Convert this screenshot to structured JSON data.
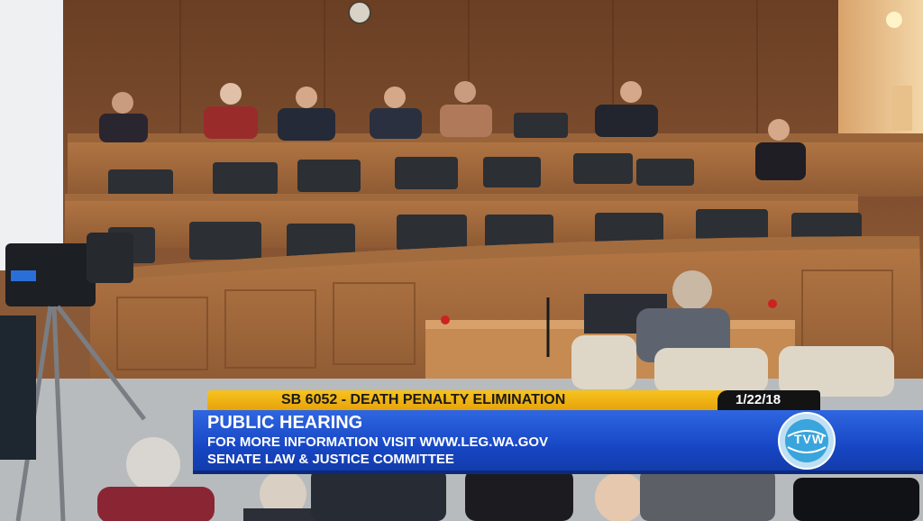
{
  "broadcast": {
    "bill_title": "SB 6052 - DEATH PENALTY ELIMINATION",
    "date": "1/22/18",
    "headline": "PUBLIC HEARING",
    "info_line": "FOR MORE INFORMATION VISIT WWW.LEG.WA.GOV",
    "committee": "SENATE LAW & JUSTICE COMMITTEE",
    "logo_text": "TVW"
  },
  "colors": {
    "banner_yellow": "#f2b817",
    "banner_blue": "#1a4fd0",
    "wood": "#8c5733"
  }
}
